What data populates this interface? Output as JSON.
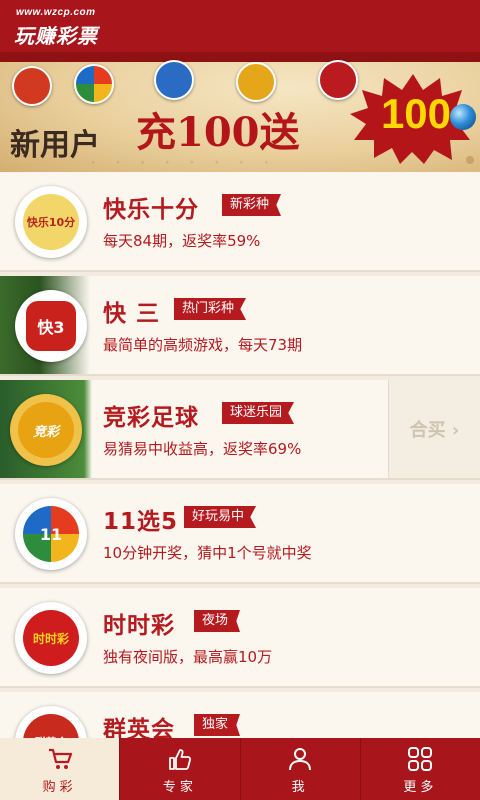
{
  "header": {
    "url": "www.wzcp.com",
    "logo": "玩赚彩票"
  },
  "banner": {
    "text_left": "新用户",
    "text_main": "充100送",
    "burst_value": "100",
    "accent": "#b41519",
    "burst_color": "#b41519",
    "burst_text_color": "#ffd800"
  },
  "lotteries": [
    {
      "title": "快乐十分",
      "tag": "新彩种",
      "desc": "每天84期，返奖率59%",
      "icon": "kuaile-shifen-icon",
      "color": "#e04c1f"
    },
    {
      "title": "快 三",
      "tag": "热门彩种",
      "desc": "最简单的高频游戏，每天73期",
      "icon": "kuai-san-dice-icon",
      "color": "#c9221c"
    },
    {
      "title": "竞彩足球",
      "tag": "球迷乐园",
      "desc": "易猜易中收益高，返奖率69%",
      "icon": "soccer-ball-icon",
      "color": "#e8a313",
      "action": "合买 ›"
    },
    {
      "title": "11选5",
      "tag": "好玩易中",
      "desc": "10分钟开奖，猜中1个号就中奖",
      "icon": "eleven-choose-five-icon",
      "color": "#e8771a"
    },
    {
      "title": "时时彩",
      "tag": "夜场",
      "desc": "独有夜间版，最高赢10万",
      "icon": "shishicai-icon",
      "color": "#cf1d1d"
    },
    {
      "title": "群英会",
      "tag": "独家",
      "desc": "",
      "icon": "qunyinghui-icon",
      "color": "#c82a1e"
    }
  ],
  "tabbar": {
    "items": [
      {
        "label": "购彩",
        "icon": "cart-icon",
        "active": true
      },
      {
        "label": "专家",
        "icon": "thumbs-up-icon",
        "active": false
      },
      {
        "label": "我",
        "icon": "user-icon",
        "active": false
      },
      {
        "label": "更多",
        "icon": "grid-icon",
        "active": false
      }
    ]
  }
}
